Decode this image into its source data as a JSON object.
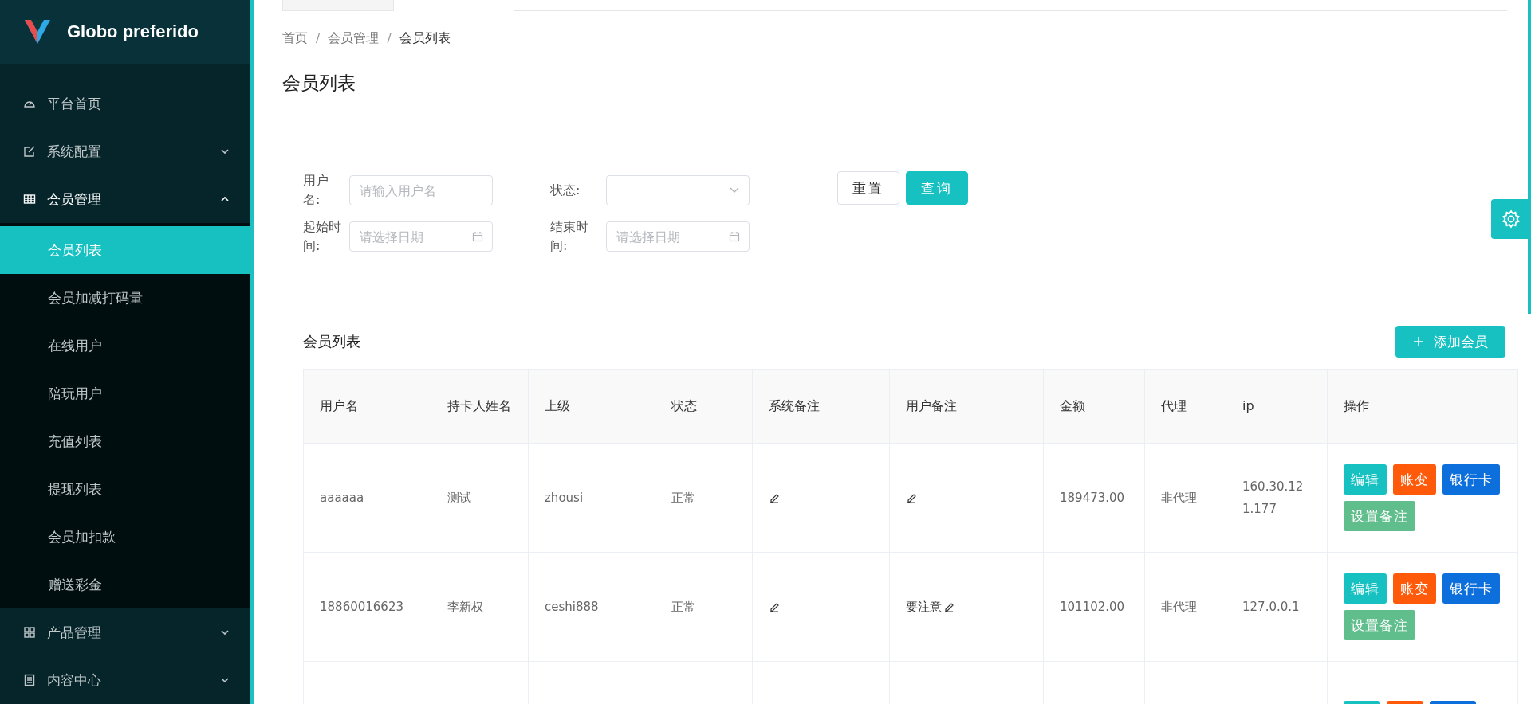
{
  "sidebar": {
    "logo_text": "Globo preferido",
    "items": [
      {
        "label": "平台首页",
        "kind": "gauge"
      },
      {
        "label": "系统配置",
        "kind": "edit",
        "expanded": false
      },
      {
        "label": "会员管理",
        "kind": "table",
        "expanded": true,
        "children": [
          {
            "label": "会员列表",
            "selected": true
          },
          {
            "label": "会员加减打码量",
            "selected": false
          },
          {
            "label": "在线用户",
            "selected": false
          },
          {
            "label": "陪玩用户",
            "selected": false
          },
          {
            "label": "充值列表",
            "selected": false
          },
          {
            "label": "提现列表",
            "selected": false
          },
          {
            "label": "会员加扣款",
            "selected": false
          },
          {
            "label": "赠送彩金",
            "selected": false
          }
        ]
      },
      {
        "label": "产品管理",
        "kind": "apps",
        "expanded": false
      },
      {
        "label": "内容中心",
        "kind": "list",
        "expanded": false
      }
    ]
  },
  "breadcrumb": {
    "separator": "/",
    "items": [
      "首页",
      "会员管理",
      "会员列表"
    ]
  },
  "page_title": "会员列表",
  "filters": [
    {
      "kind": "text",
      "label": "用户名:",
      "placeholder": "请输入用户名"
    },
    {
      "kind": "select",
      "label": "状态:"
    },
    {
      "kind": "date",
      "label": "起始时间:",
      "placeholder": "请选择日期"
    },
    {
      "kind": "date",
      "label": "结束时间:",
      "placeholder": "请选择日期"
    }
  ],
  "filter_buttons": [
    {
      "label": "重置",
      "kind": "default"
    },
    {
      "label": "查询",
      "kind": "primary"
    }
  ],
  "table_title": "会员列表",
  "add_button": "添加会员",
  "table": {
    "columns": [
      "用户名",
      "持卡人姓名",
      "上级",
      "状态",
      "系统备注",
      "用户备注",
      "金额",
      "代理",
      "ip",
      "操作"
    ],
    "rows": [
      {
        "username": "aaaaaa",
        "cardholder": "测试",
        "parent": "zhousi",
        "status": "正常",
        "amount": "189473.00",
        "agent": "非代理",
        "ip": "160.30.121.177",
        "actions": [
          {
            "label": "编辑",
            "kind": "edit"
          },
          {
            "label": "账变",
            "kind": "ledger"
          },
          {
            "label": "银行卡",
            "kind": "bank"
          },
          {
            "label": "设置备注",
            "kind": "note"
          }
        ]
      },
      {
        "username": "18860016623",
        "cardholder": "李新权",
        "parent": "ceshi888",
        "status": "正常",
        "user_note": "要注意",
        "amount": "101102.00",
        "agent": "非代理",
        "ip": "127.0.0.1",
        "actions": [
          {
            "label": "编辑",
            "kind": "edit"
          },
          {
            "label": "账变",
            "kind": "ledger"
          },
          {
            "label": "银行卡",
            "kind": "bank"
          },
          {
            "label": "设置备注",
            "kind": "note"
          }
        ]
      },
      {
        "actions": [
          {
            "kind": "edit"
          },
          {
            "kind": "ledger"
          },
          {
            "kind": "bank"
          }
        ]
      }
    ]
  }
}
